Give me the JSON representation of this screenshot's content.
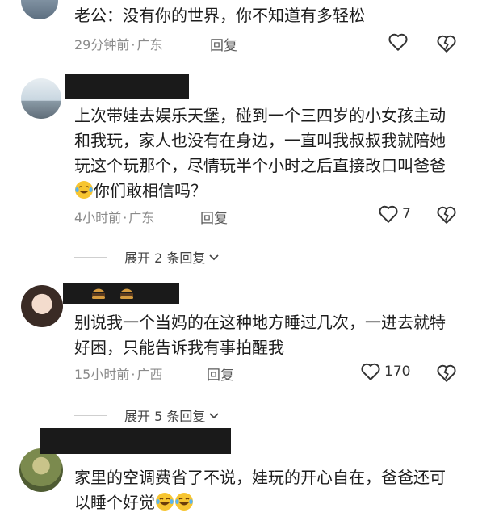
{
  "comments": [
    {
      "text": "老公：没有你的世界，你不知道有多轻松",
      "time": "29分钟前",
      "location": "广东",
      "reply": "回复",
      "likes": ""
    },
    {
      "text_before": "上次带娃去娱乐天堡，碰到一个三四岁的小女孩主动和我玩，家人也没有在身边，一直叫我叔叔我就陪她玩这个玩那个，尽情玩半个小时之后直接改口叫爸爸",
      "text_after": "你们敢相信吗？",
      "time": "4小时前",
      "location": "广东",
      "reply": "回复",
      "likes": "7",
      "expand": "展开 2 条回复"
    },
    {
      "text": "别说我一个当妈的在这种地方睡过几次，一进去就特好困，只能告诉我有事拍醒我",
      "time": "15小时前",
      "location": "广西",
      "reply": "回复",
      "likes": "170",
      "expand": "展开 5 条回复"
    },
    {
      "text_before": "家里的空调费省了不说，娃玩的开心自在，爸爸还可以睡个好觉",
      "time": "",
      "location": "",
      "reply": "",
      "likes": ""
    }
  ],
  "colors": {
    "meta": "#8a8a8a",
    "redaction": "#1a1a1a"
  },
  "icons": [
    "heart-icon",
    "broken-heart-icon",
    "chevron-down-icon",
    "laughing-tears-emoji",
    "burger-emoji"
  ]
}
